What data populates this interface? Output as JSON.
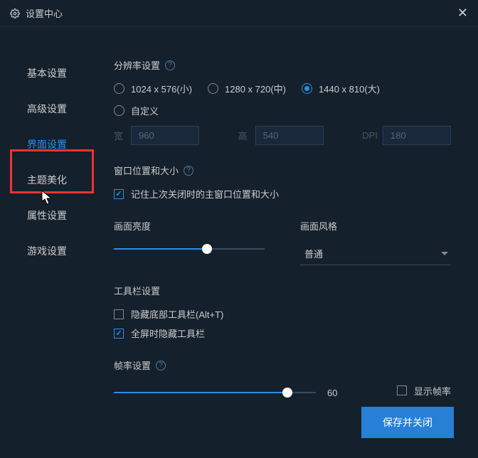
{
  "window": {
    "title": "设置中心"
  },
  "sidebar": {
    "items": [
      {
        "label": "基本设置"
      },
      {
        "label": "高级设置"
      },
      {
        "label": "界面设置"
      },
      {
        "label": "主题美化"
      },
      {
        "label": "属性设置"
      },
      {
        "label": "游戏设置"
      }
    ],
    "active_index": 2
  },
  "resolution": {
    "title": "分辨率设置",
    "options": [
      {
        "label": "1024 x 576(小)",
        "checked": false
      },
      {
        "label": "1280 x 720(中)",
        "checked": false
      },
      {
        "label": "1440 x 810(大)",
        "checked": true
      }
    ],
    "custom_label": "自定义",
    "width_label": "宽",
    "width_value": "960",
    "height_label": "高",
    "height_value": "540",
    "dpi_label": "DPI",
    "dpi_value": "180"
  },
  "window_pos": {
    "title": "窗口位置和大小",
    "remember_label": "记住上次关闭时的主窗口位置和大小",
    "remember_checked": true
  },
  "brightness": {
    "title": "画面亮度",
    "percent": 62
  },
  "style": {
    "title": "画面风格",
    "value": "普通"
  },
  "toolbar": {
    "title": "工具栏设置",
    "hide_bottom_label": "隐藏底部工具栏(Alt+T)",
    "hide_bottom_checked": false,
    "hide_fullscreen_label": "全屏时隐藏工具栏",
    "hide_fullscreen_checked": true
  },
  "fps": {
    "title": "帧率设置",
    "value": "60",
    "percent": 86,
    "show_fps_label": "显示帧率",
    "show_fps_checked": false
  },
  "actions": {
    "save": "保存并关闭"
  }
}
